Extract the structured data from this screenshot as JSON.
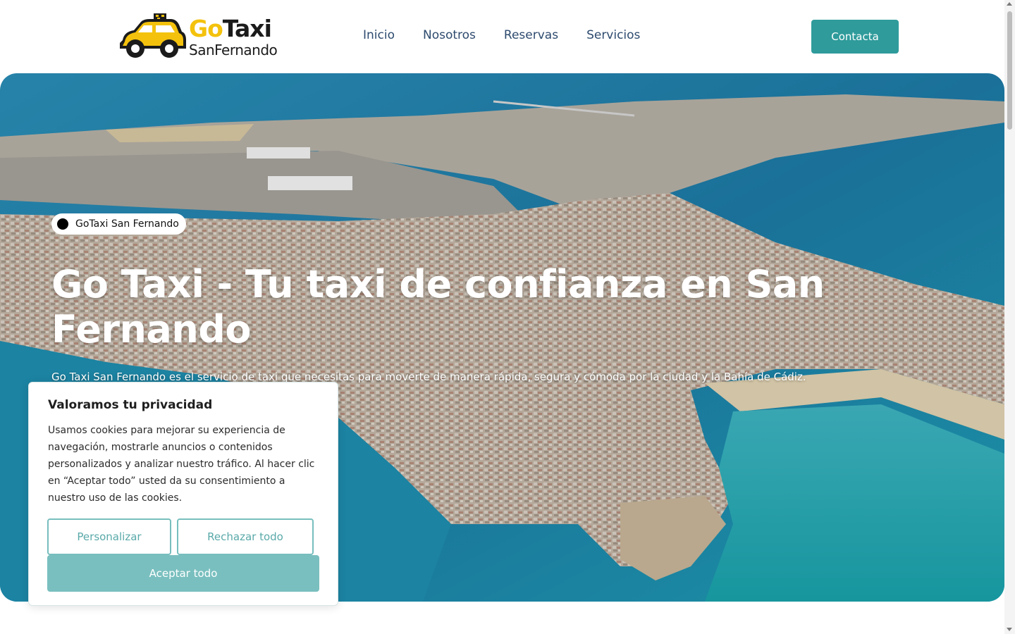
{
  "brand": {
    "logo_go": "Go",
    "logo_taxi": "Taxi",
    "logo_sub": "SanFernando",
    "primary_color": "#2f9b9b",
    "taxi_yellow": "#f4c20d"
  },
  "nav": {
    "items": [
      "Inicio",
      "Nosotros",
      "Reservas",
      "Servicios"
    ],
    "contact_label": "Contacta"
  },
  "hero": {
    "badge": "GoTaxi San Fernando",
    "title": "Go Taxi - Tu taxi de confianza en San Fernando",
    "subtitle": "Go Taxi San Fernando es el servicio de taxi que necesitas para moverte de manera rápida, segura y cómoda por la ciudad y la Bahía de Cádiz.",
    "image": "aerial-city-coast-photo"
  },
  "cookie": {
    "title": "Valoramos tu privacidad",
    "body": "Usamos cookies para mejorar su experiencia de navegación, mostrarle anuncios o contenidos personalizados y analizar nuestro tráfico. Al hacer clic en “Aceptar todo” usted da su consentimiento a nuestro uso de las cookies.",
    "customize_label": "Personalizar",
    "reject_label": "Rechazar todo",
    "accept_label": "Aceptar todo"
  }
}
